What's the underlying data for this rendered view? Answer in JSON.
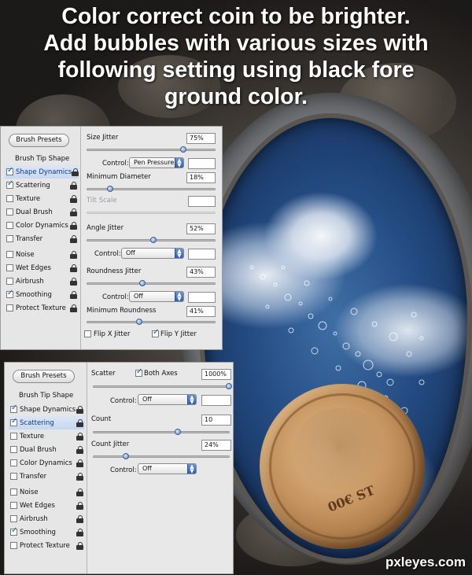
{
  "title": {
    "line1": "Color correct coin to be brighter.",
    "line2": "Add bubbles with various sizes with",
    "line3": "following setting using black fore",
    "line4": "ground color."
  },
  "watermark": "pxleyes.com",
  "coin_text": "00€ ST",
  "panel1": {
    "presets_label": "Brush Presets",
    "tip_shape_label": "Brush Tip Shape",
    "options": [
      {
        "label": "Shape Dynamics",
        "checked": true,
        "selected": true
      },
      {
        "label": "Scattering",
        "checked": true,
        "selected": false
      },
      {
        "label": "Texture",
        "checked": false,
        "selected": false
      },
      {
        "label": "Dual Brush",
        "checked": false,
        "selected": false
      },
      {
        "label": "Color Dynamics",
        "checked": false,
        "selected": false
      },
      {
        "label": "Transfer",
        "checked": false,
        "selected": false
      },
      {
        "label": "Noise",
        "checked": false,
        "selected": false
      },
      {
        "label": "Wet Edges",
        "checked": false,
        "selected": false
      },
      {
        "label": "Airbrush",
        "checked": false,
        "selected": false
      },
      {
        "label": "Smoothing",
        "checked": true,
        "selected": false
      },
      {
        "label": "Protect Texture",
        "checked": false,
        "selected": false
      }
    ],
    "size_jitter_label": "Size Jitter",
    "size_jitter_value": "75%",
    "size_jitter_level": 0.75,
    "control_label": "Control:",
    "control1_value": "Pen Pressure",
    "control1_field": "",
    "min_diameter_label": "Minimum Diameter",
    "min_diameter_value": "18%",
    "min_diameter_level": 0.18,
    "tilt_scale_label": "Tilt Scale",
    "tilt_scale_value": "",
    "angle_jitter_label": "Angle Jitter",
    "angle_jitter_value": "52%",
    "angle_jitter_level": 0.52,
    "control2_value": "Off",
    "control2_field": "",
    "roundness_jitter_label": "Roundness Jitter",
    "roundness_jitter_value": "43%",
    "roundness_jitter_level": 0.43,
    "control3_value": "Off",
    "control3_field": "",
    "min_roundness_label": "Minimum Roundness",
    "min_roundness_value": "41%",
    "min_roundness_level": 0.41,
    "flip_x_label": "Flip X Jitter",
    "flip_x_checked": false,
    "flip_y_label": "Flip Y Jitter",
    "flip_y_checked": true
  },
  "panel2": {
    "presets_label": "Brush Presets",
    "tip_shape_label": "Brush Tip Shape",
    "options": [
      {
        "label": "Shape Dynamics",
        "checked": true,
        "selected": false
      },
      {
        "label": "Scattering",
        "checked": true,
        "selected": true
      },
      {
        "label": "Texture",
        "checked": false,
        "selected": false
      },
      {
        "label": "Dual Brush",
        "checked": false,
        "selected": false
      },
      {
        "label": "Color Dynamics",
        "checked": false,
        "selected": false
      },
      {
        "label": "Transfer",
        "checked": false,
        "selected": false
      },
      {
        "label": "Noise",
        "checked": false,
        "selected": false
      },
      {
        "label": "Wet Edges",
        "checked": false,
        "selected": false
      },
      {
        "label": "Airbrush",
        "checked": false,
        "selected": false
      },
      {
        "label": "Smoothing",
        "checked": true,
        "selected": false
      },
      {
        "label": "Protect Texture",
        "checked": false,
        "selected": false
      }
    ],
    "scatter_label": "Scatter",
    "both_axes_label": "Both Axes",
    "both_axes_checked": true,
    "scatter_value": "1000%",
    "scatter_level": 1.0,
    "control_label": "Control:",
    "control1_value": "Off",
    "control1_field": "",
    "count_label": "Count",
    "count_value": "10",
    "count_level": 0.62,
    "count_jitter_label": "Count Jitter",
    "count_jitter_value": "24%",
    "count_jitter_level": 0.24,
    "control2_value": "Off"
  },
  "colors": {
    "accent": "#2c5fb5",
    "panel_bg": "#e8e8e8",
    "selected_row": "#c9d8ef"
  }
}
